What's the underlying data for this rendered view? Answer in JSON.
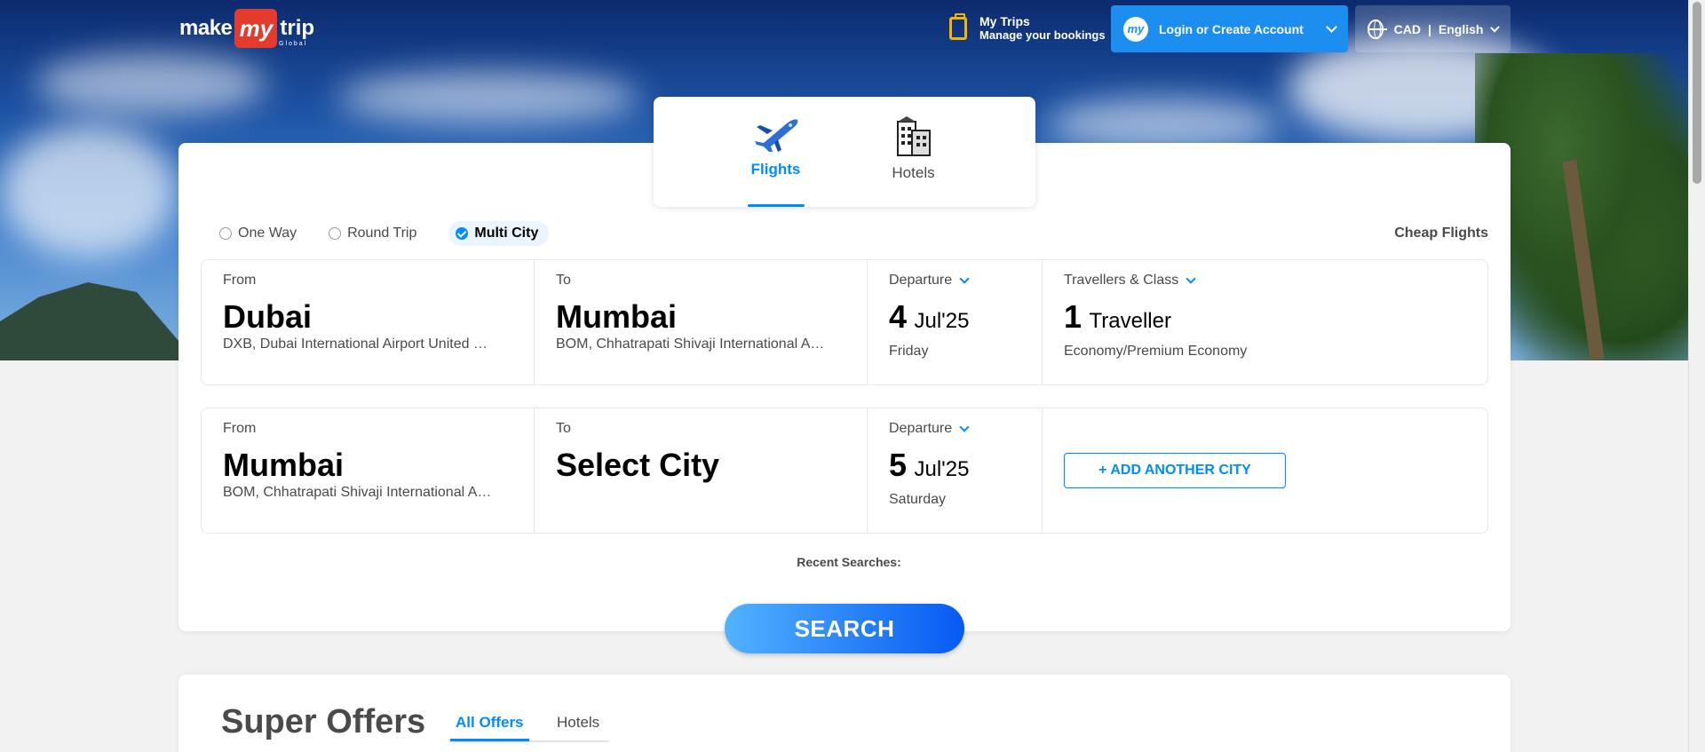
{
  "header": {
    "logo": {
      "word1": "make",
      "mark": "my",
      "word2": "trip",
      "tagline": "Global"
    },
    "my_trips": {
      "title": "My Trips",
      "subtitle": "Manage your bookings"
    },
    "login": {
      "avatar_text": "my",
      "label": "Login or Create Account"
    },
    "locale": {
      "currency": "CAD",
      "separator": "|",
      "language": "English"
    }
  },
  "product_tabs": [
    {
      "label": "Flights",
      "active": true,
      "icon": "airplane-icon"
    },
    {
      "label": "Hotels",
      "active": false,
      "icon": "hotel-building-icon"
    }
  ],
  "trip_types": [
    {
      "label": "One Way",
      "selected": false
    },
    {
      "label": "Round Trip",
      "selected": false
    },
    {
      "label": "Multi City",
      "selected": true
    }
  ],
  "cheap_flights_link": "Cheap Flights",
  "legs": [
    {
      "from": {
        "label": "From",
        "city": "Dubai",
        "airport": "DXB, Dubai International Airport United …"
      },
      "to": {
        "label": "To",
        "city": "Mumbai",
        "airport": "BOM, Chhatrapati Shivaji International A…"
      },
      "departure": {
        "label": "Departure",
        "day": "4",
        "month_year": "Jul'25",
        "weekday": "Friday"
      },
      "travellers": {
        "label": "Travellers & Class",
        "count": "1",
        "unit": "Traveller",
        "class": "Economy/Premium Economy"
      }
    },
    {
      "from": {
        "label": "From",
        "city": "Mumbai",
        "airport": "BOM, Chhatrapati Shivaji International A…"
      },
      "to": {
        "label": "To",
        "city": "Select City",
        "airport": ""
      },
      "departure": {
        "label": "Departure",
        "day": "5",
        "month_year": "Jul'25",
        "weekday": "Saturday"
      },
      "add_city_label": "+ ADD ANOTHER CITY"
    }
  ],
  "recent_searches_label": "Recent Searches:",
  "search_button": "SEARCH",
  "offers": {
    "title": "Super Offers",
    "tabs": [
      {
        "label": "All Offers",
        "active": true
      },
      {
        "label": "Hotels",
        "active": false
      }
    ]
  },
  "colors": {
    "accent": "#008cff",
    "login_bg": "#1c8ef0",
    "logo_red": "#e33b2e",
    "search_gradient_start": "#53b2fe",
    "search_gradient_end": "#065af3"
  }
}
